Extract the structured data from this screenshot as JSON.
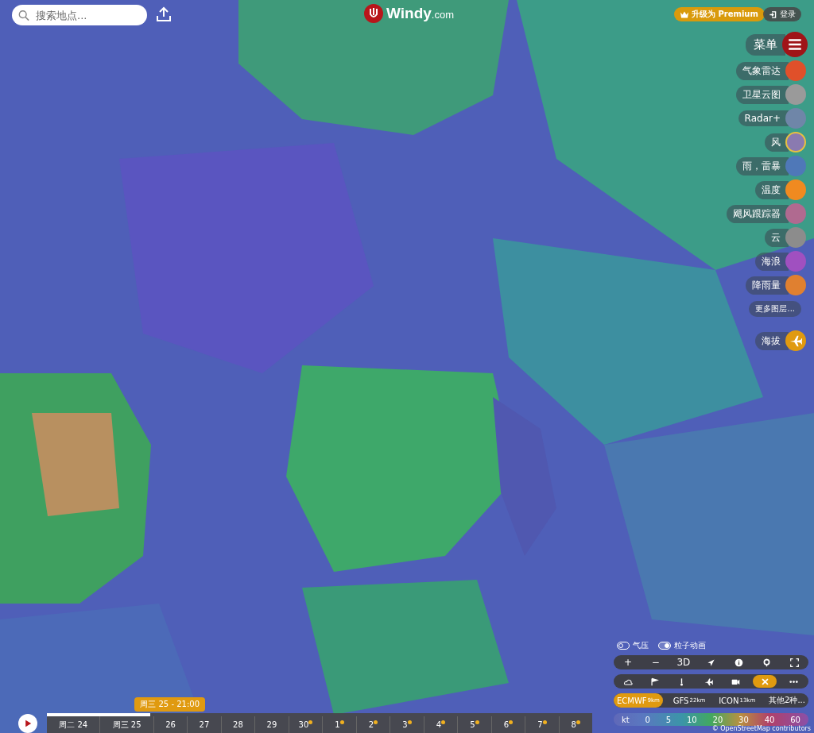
{
  "search": {
    "placeholder": "搜索地点..."
  },
  "logo": {
    "name": "Windy",
    "suffix": ".com"
  },
  "premium_button": "升级为 Premium",
  "login_button": "登录",
  "menu": {
    "label": "菜单"
  },
  "layers": [
    {
      "label": "气象雷达",
      "selected": false,
      "color": "#e0502a"
    },
    {
      "label": "卫星云图",
      "selected": false,
      "color": "#9a9a9a"
    },
    {
      "label": "Radar+",
      "selected": false,
      "color": "#6f86a8"
    },
    {
      "label": "风",
      "selected": true,
      "color": "#8a7ab0"
    },
    {
      "label": "雨，雷暴",
      "selected": false,
      "color": "#4f78b8"
    },
    {
      "label": "温度",
      "selected": false,
      "color": "#f08a20"
    },
    {
      "label": "飓风跟踪器",
      "selected": false,
      "color": "#b06a90"
    },
    {
      "label": "云",
      "selected": false,
      "color": "#8c8c8c"
    },
    {
      "label": "海浪",
      "selected": false,
      "color": "#a050c0"
    },
    {
      "label": "降雨量",
      "selected": false,
      "color": "#e08030"
    }
  ],
  "more_layers": "更多图层...",
  "altitude": {
    "label": "海拔"
  },
  "toggles": [
    {
      "label": "气压",
      "on": false
    },
    {
      "label": "粒子动画",
      "on": true
    }
  ],
  "tools": [
    {
      "kind": "text",
      "label": "+"
    },
    {
      "kind": "text",
      "label": "−"
    },
    {
      "kind": "text",
      "label": "3D"
    },
    {
      "kind": "locate"
    },
    {
      "kind": "info"
    },
    {
      "kind": "pin"
    },
    {
      "kind": "fullscreen"
    }
  ],
  "tools_2": [
    {
      "kind": "cloud",
      "selected": false
    },
    {
      "kind": "flag",
      "selected": false
    },
    {
      "kind": "thermometer",
      "selected": false
    },
    {
      "kind": "plane",
      "selected": false
    },
    {
      "kind": "camera",
      "selected": false
    },
    {
      "kind": "close",
      "selected": true
    },
    {
      "kind": "more",
      "selected": false
    }
  ],
  "models": [
    {
      "name": "ECMWF",
      "resolution": "9km",
      "selected": true
    },
    {
      "name": "GFS",
      "resolution": "22km",
      "selected": false
    },
    {
      "name": "ICON",
      "resolution": "13km",
      "selected": false
    },
    {
      "name": "其他2种...",
      "selected": false
    }
  ],
  "legend": {
    "unit": "kt",
    "values": [
      "0",
      "5",
      "10",
      "20",
      "30",
      "40",
      "60"
    ]
  },
  "attribution": "© OpenStreetMap contributors",
  "timeline": {
    "current": "周三 25 - 21:00",
    "level": 0.19,
    "days": [
      {
        "label": "周二 24",
        "premium": false
      },
      {
        "label": "周三 25",
        "premium": false
      },
      {
        "label": "26",
        "premium": false
      },
      {
        "label": "27",
        "premium": false
      },
      {
        "label": "28",
        "premium": false
      },
      {
        "label": "29",
        "premium": false
      },
      {
        "label": "30",
        "premium": true
      },
      {
        "label": "1",
        "premium": true
      },
      {
        "label": "2",
        "premium": true
      },
      {
        "label": "3",
        "premium": true
      },
      {
        "label": "4",
        "premium": true
      },
      {
        "label": "5",
        "premium": true
      },
      {
        "label": "6",
        "premium": true
      },
      {
        "label": "7",
        "premium": true
      },
      {
        "label": "8",
        "premium": true
      }
    ]
  }
}
